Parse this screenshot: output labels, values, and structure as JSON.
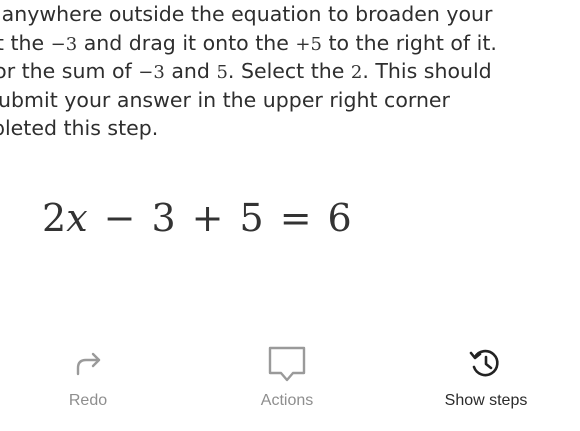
{
  "instructions": {
    "line1": "ck anywhere outside the equation to broaden your",
    "line2_a": "ect the",
    "line2_math1": "−3",
    "line2_b": "and drag it onto the",
    "line2_math2": "+5",
    "line2_c": "to the right of it.",
    "line3_a": "r for the sum of",
    "line3_math1": "−3",
    "line3_b": "and",
    "line3_math2": "5",
    "line3_c": ". Select the",
    "line3_math3": "2",
    "line3_d": ". This should",
    "line4": ". Submit your answer in the upper right corner",
    "line5": "mpleted this step."
  },
  "equation": {
    "coef": "2",
    "var": "x",
    "op1": "−",
    "term1": "3",
    "op2": "+",
    "term2": "5",
    "eq": "=",
    "rhs": "6"
  },
  "toolbar": {
    "redo_label": "Redo",
    "redo_icon": "redo-arrow-icon",
    "actions_label": "Actions",
    "actions_icon": "speech-bubble-icon",
    "steps_label": "Show steps",
    "steps_icon": "history-clock-icon"
  },
  "colors": {
    "text": "#2b2b2b",
    "muted": "#8e8e8e",
    "icon_muted": "#9a9a9a",
    "icon_active": "#222222",
    "background": "#ffffff"
  }
}
